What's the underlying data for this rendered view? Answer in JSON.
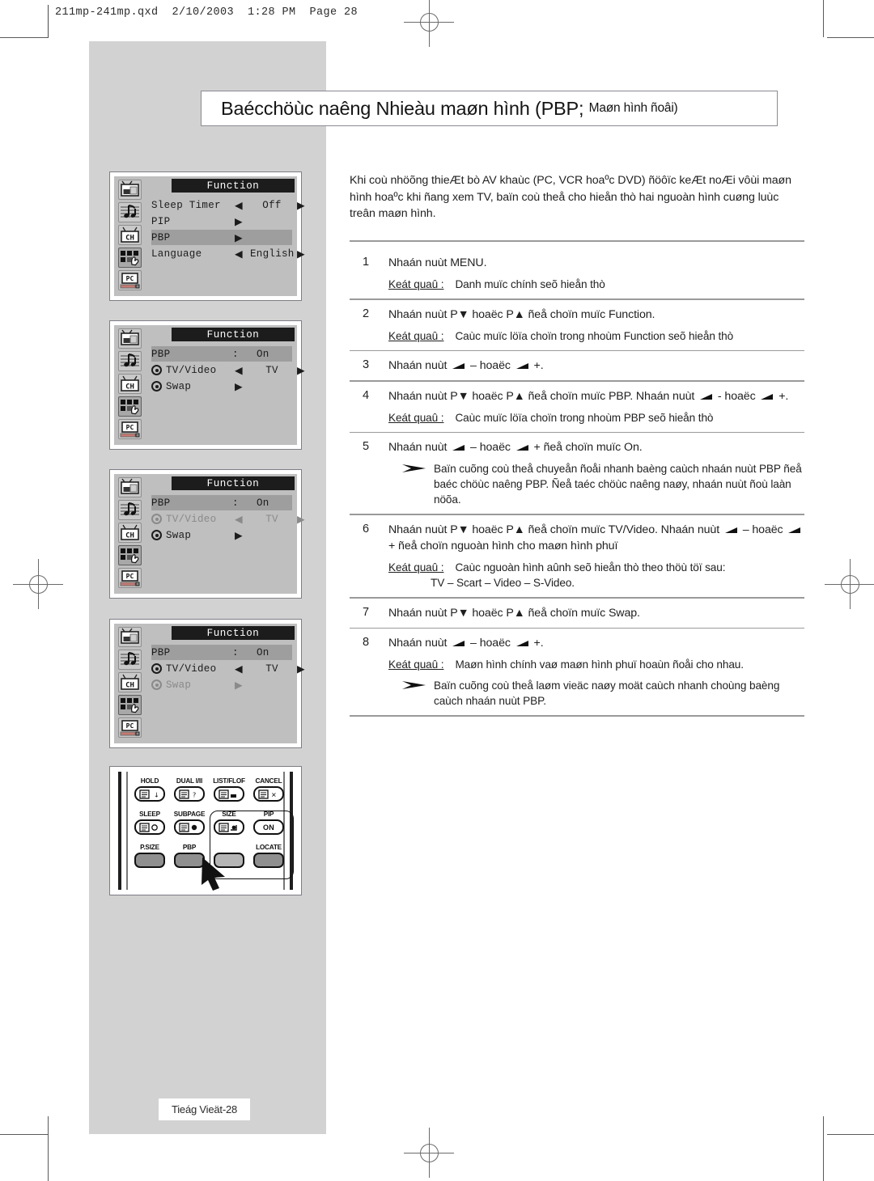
{
  "print_header": {
    "text": "211mp-241mp.qxd  2/10/2003  1:28 PM  Page 28"
  },
  "title": {
    "main": "Baécchöùc naêng Nhieàu maøn hình (PBP; ",
    "sub": "Maøn hình ñoâi)"
  },
  "intro": {
    "text": "Khi coù nhöõng thieÆt bò AV khaùc (PC, VCR hoaºc DVD) ñöôïc keÆt noÆi vôùi maøn hình hoaºc khi ñang xem TV, baïn coù theå cho hieån thò hai nguoàn hình cuøng luùc treân maøn hình."
  },
  "osd_panels": [
    {
      "name": "panel-function-menu",
      "header": "Function",
      "rows": [
        {
          "label": "Sleep Timer",
          "left_arrow": "◀",
          "value": "Off",
          "right_arrow": "▶",
          "style": "normal",
          "kind": "value"
        },
        {
          "label": "PIP",
          "mid_arrow": "▶",
          "style": "normal",
          "kind": "submenu"
        },
        {
          "label": "PBP",
          "mid_arrow": "▶",
          "style": "highlight",
          "kind": "submenu"
        },
        {
          "label": "Language",
          "left_arrow": "◀",
          "value": "English",
          "right_arrow": "▶",
          "style": "normal",
          "kind": "value"
        }
      ]
    },
    {
      "name": "panel-pbp-on-tvvideo",
      "header": "Function",
      "rows": [
        {
          "label": "PBP",
          "colon": ":",
          "value": "On",
          "style": "highlight",
          "kind": "header-on"
        },
        {
          "label": "TV/Video",
          "radio": true,
          "left_arrow": "◀",
          "value": "TV",
          "right_arrow": "▶",
          "style": "normal",
          "kind": "value"
        },
        {
          "label": "Swap",
          "radio": true,
          "mid_arrow": "▶",
          "style": "normal",
          "kind": "submenu"
        }
      ]
    },
    {
      "name": "panel-swap-selected",
      "header": "Function",
      "rows": [
        {
          "label": "PBP",
          "colon": ":",
          "value": "On",
          "style": "highlight",
          "kind": "header-on"
        },
        {
          "label": "TV/Video",
          "radio": true,
          "left_arrow": "◀",
          "value": "TV",
          "right_arrow": "▶",
          "style": "dim",
          "kind": "value"
        },
        {
          "label": "Swap",
          "radio": true,
          "mid_arrow": "▶",
          "style": "normal",
          "kind": "submenu"
        }
      ]
    },
    {
      "name": "panel-tvvideo-selected",
      "header": "Function",
      "rows": [
        {
          "label": "PBP",
          "colon": ":",
          "value": "On",
          "style": "highlight",
          "kind": "header-on"
        },
        {
          "label": "TV/Video",
          "radio": true,
          "left_arrow": "◀",
          "value": "TV",
          "right_arrow": "▶",
          "style": "normal",
          "kind": "value"
        },
        {
          "label": "Swap",
          "radio": true,
          "mid_arrow": "▶",
          "style": "dim",
          "kind": "submenu"
        }
      ]
    }
  ],
  "rail_icons": [
    "tv-picture-icon",
    "sound-note-icon",
    "channel-ch-icon",
    "function-hand-icon",
    "pc-icon"
  ],
  "remote": {
    "rows": [
      [
        {
          "label": "HOLD",
          "type": "outline",
          "glyph": "hold"
        },
        {
          "label": "DUAL I/II",
          "type": "outline",
          "glyph": "dual"
        },
        {
          "label": "LIST/FLOF",
          "type": "outline",
          "glyph": "list"
        },
        {
          "label": "CANCEL",
          "type": "outline",
          "glyph": "cancel"
        }
      ],
      [
        {
          "label": "SLEEP",
          "type": "outline",
          "glyph": "sleep"
        },
        {
          "label": "SUBPAGE",
          "type": "outline",
          "glyph": "subpage"
        },
        {
          "label": "SIZE",
          "type": "outline",
          "glyph": "size"
        },
        {
          "label": "PIP",
          "type": "outline",
          "glyph": "text",
          "text": "ON"
        }
      ],
      [
        {
          "label": "P.SIZE",
          "type": "solid",
          "glyph": ""
        },
        {
          "label": "PBP",
          "type": "solid",
          "glyph": ""
        },
        {
          "label": "",
          "type": "solid-light",
          "glyph": ""
        },
        {
          "label": "LOCATE",
          "type": "solid",
          "glyph": ""
        }
      ]
    ],
    "pointer": "cursor-arrow-icon"
  },
  "steps": [
    {
      "num": "1",
      "text": "Nhaán nuùt MENU.",
      "result_label": "Keát quaû :",
      "result_text": "Danh muïc chính seõ hieån thò"
    },
    {
      "num": "2",
      "text": "Nhaán nuùt P▼ hoaëc P▲ ñeå choïn muïc Function.",
      "result_label": "Keát quaû :",
      "result_text": "Caùc muïc löïa choïn trong nhoùm Function seõ hieån thò"
    },
    {
      "num": "3",
      "text_prefix": "Nhaán nuùt ",
      "vol_minus": " – ",
      "text_mid": "hoaëc ",
      "vol_plus": " +.",
      "kind": "vol"
    },
    {
      "num": "4",
      "text_prefix": "Nhaán nuùt P▼ hoaëc P▲ ñeå choïn muïc PBP. Nhaán nuùt ",
      "vol_minus": " - ",
      "text_mid": "hoaëc ",
      "vol_plus": " +.",
      "kind": "vol",
      "result_label": "Keát quaû :",
      "result_text": "Caùc muïc löïa choïn trong nhoùm PBP seõ hieån thò"
    },
    {
      "num": "5",
      "text_prefix": "Nhaán nuùt ",
      "vol_minus": " – ",
      "text_mid": "hoaëc ",
      "vol_plus": " + ñeå choïn muïc On.",
      "kind": "vol",
      "note_text": "Baïn cuõng coù theå chuyeån ñoåi nhanh baèng caùch nhaán nuùt PBP ñeå baéc chöùc naêng PBP. Ñeå taéc chöùc naêng naøy, nhaán nuùt ñoù laàn nöõa."
    },
    {
      "num": "6",
      "text_prefix": "Nhaán nuùt P▼ hoaëc P▲ ñeå choïn muïc TV/Video. Nhaán nuùt ",
      "vol_minus": " – ",
      "text_mid": "hoaëc ",
      "vol_plus": " + ñeå choïn nguoàn hình cho maøn hình phuï",
      "kind": "vol",
      "result_label": "Keát quaû :",
      "result_text": "Caùc nguoàn hình aûnh seõ hieån thò theo thöù töï sau:",
      "result_text2": "TV – Scart – Video – S-Video."
    },
    {
      "num": "7",
      "text": "Nhaán nuùt P▼ hoaëc P▲ ñeå choïn muïc Swap."
    },
    {
      "num": "8",
      "text_prefix": "Nhaán nuùt ",
      "vol_minus": " – ",
      "text_mid": "hoaëc ",
      "vol_plus": " +.",
      "kind": "vol",
      "result_label": "Keát quaû :",
      "result_text": "Maøn hình chính vaø maøn hình phuï hoaùn ñoåi cho nhau.",
      "note_text": "Baïn cuõng coù theå laøm vieäc naøy moät caùch nhanh choùng baèng caùch nhaán nuùt PBP."
    }
  ],
  "footer": {
    "text": "Tieág Vieät-28"
  },
  "colors": {
    "band": "#d2d2d2",
    "osd_bg": "#bfbfbf",
    "osd_highlight": "#9e9e9e",
    "osd_headerbar": "#1c1c1c",
    "rule": "#9a9a9a",
    "text": "#1f1f1f"
  }
}
